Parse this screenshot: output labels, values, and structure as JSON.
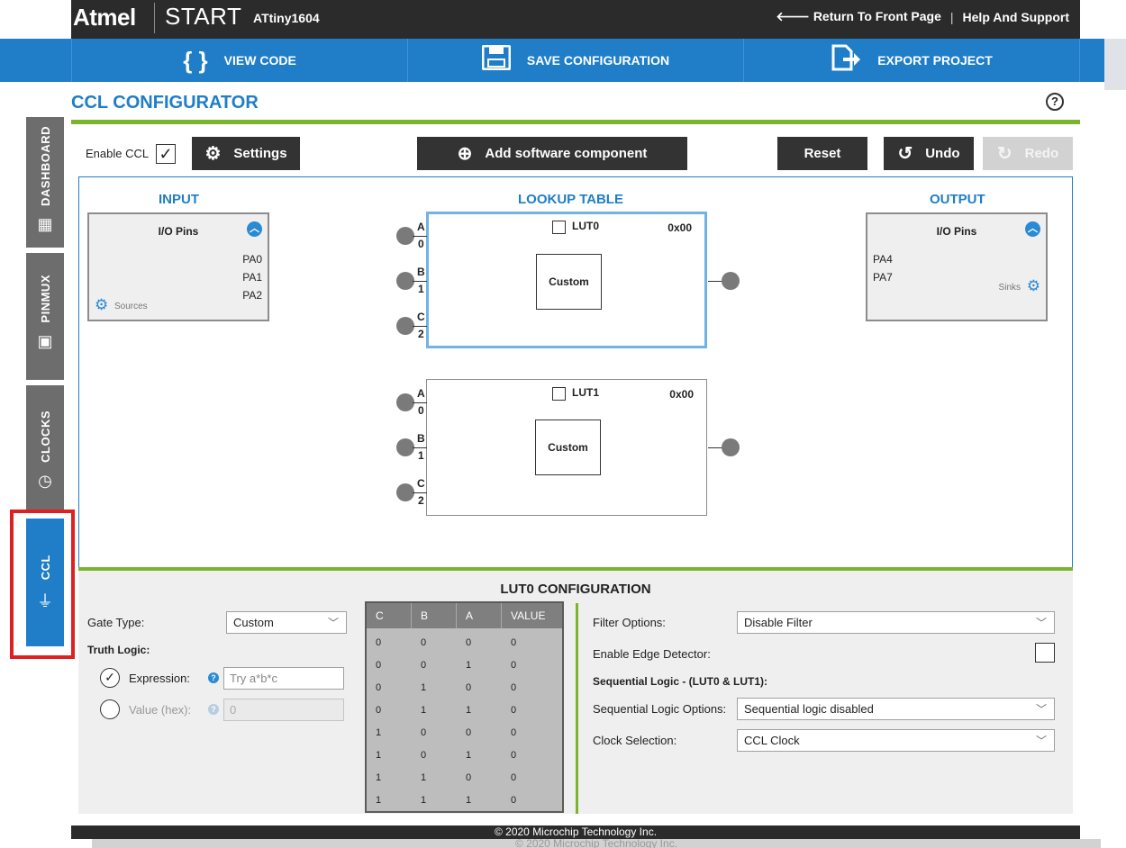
{
  "header": {
    "brand": "Atmel",
    "product": "START",
    "device": "ATtiny1604",
    "return_link": "Return To Front Page",
    "separator": "|",
    "help_link": "Help And Support"
  },
  "actions": {
    "view_code": "VIEW CODE",
    "save_configuration": "SAVE CONFIGURATION",
    "export_project": "EXPORT PROJECT"
  },
  "page": {
    "title": "CCL CONFIGURATOR",
    "help_icon": "?"
  },
  "sidebar": {
    "tabs": [
      {
        "label": "DASHBOARD",
        "icon": "dashboard-icon"
      },
      {
        "label": "PINMUX",
        "icon": "chip-icon"
      },
      {
        "label": "CLOCKS",
        "icon": "clock-icon"
      },
      {
        "label": "CCL",
        "icon": "gate-icon",
        "active": true
      }
    ]
  },
  "toolbar": {
    "enable_ccl_label": "Enable CCL",
    "enable_ccl_checked": true,
    "settings": "Settings",
    "add_component": "Add software component",
    "reset": "Reset",
    "undo": "Undo",
    "redo": "Redo"
  },
  "canvas": {
    "input_heading": "INPUT",
    "lookup_heading": "LOOKUP TABLE",
    "output_heading": "OUTPUT",
    "input_box": {
      "title": "I/O Pins",
      "pins": [
        "PA0",
        "PA1",
        "PA2"
      ],
      "footer": "Sources"
    },
    "output_box": {
      "title": "I/O Pins",
      "pins": [
        "PA4",
        "PA7"
      ],
      "footer": "Sinks"
    },
    "luts": [
      {
        "name": "LUT0",
        "value": "0x00",
        "gate": "Custom",
        "inputs": [
          {
            "letter": "A",
            "num": "0"
          },
          {
            "letter": "B",
            "num": "1"
          },
          {
            "letter": "C",
            "num": "2"
          }
        ]
      },
      {
        "name": "LUT1",
        "value": "0x00",
        "gate": "Custom",
        "inputs": [
          {
            "letter": "A",
            "num": "0"
          },
          {
            "letter": "B",
            "num": "1"
          },
          {
            "letter": "C",
            "num": "2"
          }
        ]
      }
    ]
  },
  "config": {
    "title": "LUT0 CONFIGURATION",
    "gate_type_label": "Gate Type:",
    "gate_type_value": "Custom",
    "truth_logic_label": "Truth Logic:",
    "expression_label": "Expression:",
    "expression_placeholder": "Try a*b*c",
    "value_label": "Value (hex):",
    "value_placeholder": "0",
    "truth_table": {
      "headers": [
        "C",
        "B",
        "A",
        "VALUE"
      ],
      "rows": [
        [
          "0",
          "0",
          "0",
          "0"
        ],
        [
          "0",
          "0",
          "1",
          "0"
        ],
        [
          "0",
          "1",
          "0",
          "0"
        ],
        [
          "0",
          "1",
          "1",
          "0"
        ],
        [
          "1",
          "0",
          "0",
          "0"
        ],
        [
          "1",
          "0",
          "1",
          "0"
        ],
        [
          "1",
          "1",
          "0",
          "0"
        ],
        [
          "1",
          "1",
          "1",
          "0"
        ]
      ]
    },
    "filter_options_label": "Filter Options:",
    "filter_options_value": "Disable Filter",
    "edge_detector_label": "Enable Edge Detector:",
    "sequential_heading": "Sequential Logic - (LUT0 & LUT1):",
    "sequential_options_label": "Sequential Logic Options:",
    "sequential_options_value": "Sequential logic disabled",
    "clock_selection_label": "Clock Selection:",
    "clock_selection_value": "CCL Clock"
  },
  "footer": {
    "copyright": "© 2020 Microchip Technology Inc."
  },
  "colors": {
    "accent_blue": "#1f7ec7",
    "accent_green": "#7bb52e",
    "dark": "#2b2b2b",
    "highlight_red": "#e02020"
  }
}
